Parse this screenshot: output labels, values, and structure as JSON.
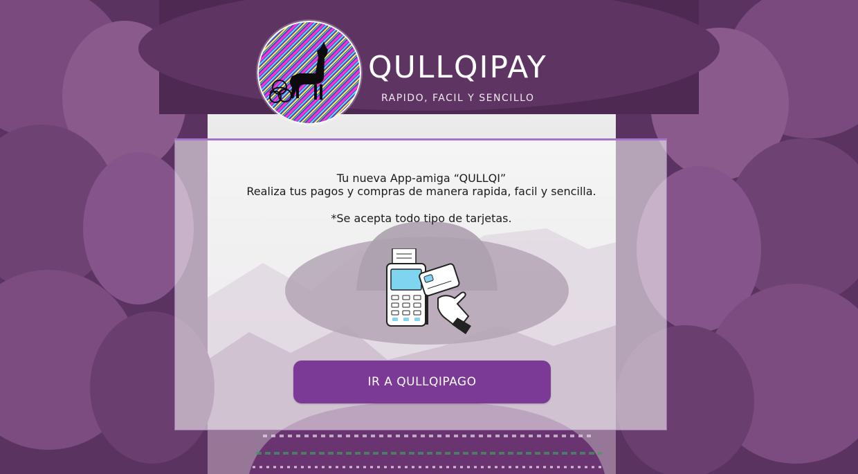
{
  "brand": {
    "name": "QULLQIPAY",
    "tagline": "RAPIDO, FACIL Y SENCILLO",
    "logo_icon": "llama-icon"
  },
  "card": {
    "line1": "Tu nueva App-amiga “QULLQI”",
    "line2": "Realiza tus pagos y compras de manera rapida, facil y sencilla.",
    "line3": "*Se acepta todo tipo de tarjetas.",
    "illustration_icon": "card-terminal-icon",
    "cta_label": "IR A QULLQIPAGO"
  },
  "colors": {
    "primary": "#7b3a96",
    "accent": "#a374c9",
    "stone": "#7a4a7e"
  }
}
